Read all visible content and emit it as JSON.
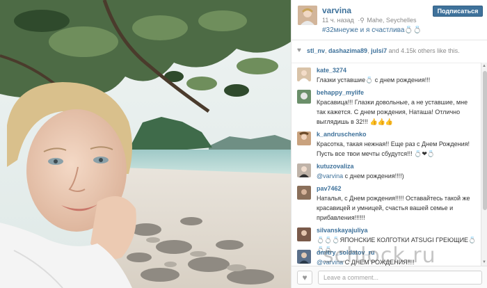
{
  "post": {
    "username": "varvina",
    "time": "11 ч. назад",
    "location": "Mahe, Seychelles",
    "caption": "#32мнеуже и я счастлива💍💍",
    "follow_label": "Подписаться"
  },
  "likes": {
    "likers": [
      "stl_nv",
      "dashazima89",
      "julsi7"
    ],
    "separator1": ", ",
    "separator2": ", ",
    "and_text": " and ",
    "count": "4.15k",
    "suffix": " others like this."
  },
  "comments": [
    {
      "user": "kate_3274",
      "text": "Глазки уставшие💍 с днем рождения!!!",
      "avatar_color": "#d9c3a8"
    },
    {
      "user": "behappy_mylife",
      "text": "Красавица!!! Глазки довольные, а не уставшие, мне так кажется. С днем рождения, Наташа! Отлично выглядишь в 32!!! 👍👍👍",
      "avatar_color": "#6b8f6a"
    },
    {
      "user": "k_andruschenko",
      "text": "Красотка, такая нежная!! Еще раз с Днем Рождения! Пусть все твои мечты сбудутся!!! 💍❤💍",
      "avatar_color": "#c9a27e"
    },
    {
      "user": "kutuzovaliza",
      "mention": "@varvina",
      "text": " с днем рождения!!!!)",
      "avatar_color": "#bfb3a8"
    },
    {
      "user": "pav7462",
      "text": "Наталья, с Днем рождения!!!!! Оставайтесь такой же красавицей и умницей, счастья вашей семье и прибавления!!!!!!",
      "avatar_color": "#8a6f5a"
    },
    {
      "user": "silvanskayajuliya",
      "text": "💍💍💍ЯПОНСКИЕ КОЛГОТКИ ATSUGI ГРЕЮЩИЕ💍💍💍",
      "avatar_color": "#7a5a4a"
    },
    {
      "user": "dmitry_soldatov_ru",
      "mention": "@varvina",
      "text": " С ДНЕМ РОЖДЕНИЯ!!!!",
      "avatar_color": "#5a6f8a"
    }
  ],
  "footer": {
    "comment_placeholder": "Leave a comment..."
  },
  "watermark": "schlock.ru",
  "colors": {
    "link": "#3f729b",
    "follow_button": "#3f729b"
  }
}
